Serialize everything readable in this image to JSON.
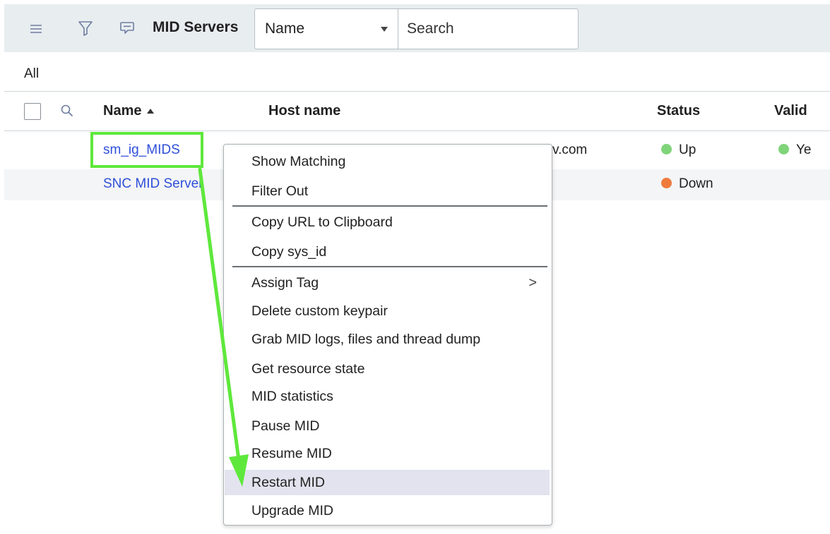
{
  "header": {
    "title": "MID Servers",
    "icons": [
      "hamburger-menu-icon",
      "funnel-filter-icon",
      "chat-bubble-icon"
    ],
    "search_field_select": "Name",
    "search_placeholder": "Search"
  },
  "breadcrumb": "All",
  "columns": {
    "name": "Name",
    "host": "Host name",
    "status": "Status",
    "validated": "Valid"
  },
  "rows": [
    {
      "name": "sm_ig_MIDS",
      "host": "v.com",
      "status": "Up",
      "status_color": "#7fd47a",
      "validated": "Ye",
      "validated_color": "#7fd47a"
    },
    {
      "name": "SNC MID Server",
      "host": "",
      "status": "Down",
      "status_color": "#f07a3c",
      "validated": ""
    }
  ],
  "context_menu": {
    "items": [
      {
        "label": "Show Matching"
      },
      {
        "label": "Filter Out"
      },
      {
        "label": "Copy URL to Clipboard"
      },
      {
        "label": "Copy sys_id"
      },
      {
        "label": "Assign Tag",
        "submenu_glyph": ">"
      },
      {
        "label": "Delete custom keypair"
      },
      {
        "label": "Grab MID logs, files and thread dump"
      },
      {
        "label": "Get resource state"
      },
      {
        "label": "MID statistics"
      },
      {
        "label": "Pause MID"
      },
      {
        "label": "Resume MID"
      },
      {
        "label": "Restart MID"
      },
      {
        "label": "Upgrade MID"
      }
    ],
    "active_item": "Restart MID"
  },
  "annotation": {
    "color": "#5fe83c"
  }
}
